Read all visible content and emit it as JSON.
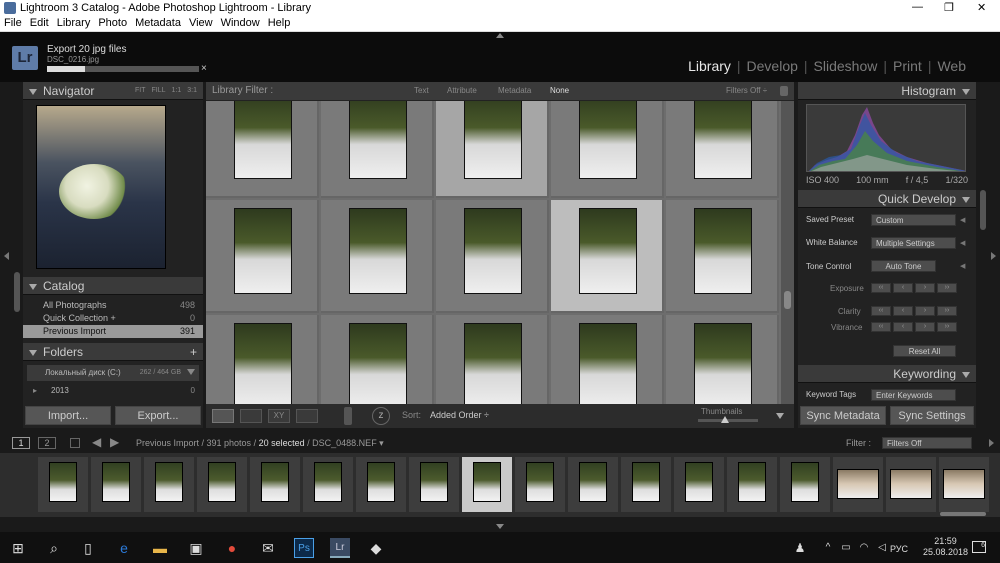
{
  "window": {
    "title": "Lightroom 3 Catalog - Adobe Photoshop Lightroom - Library",
    "controls": [
      "—",
      "❐",
      "✕"
    ]
  },
  "menu": [
    "File",
    "Edit",
    "Library",
    "Photo",
    "Metadata",
    "View",
    "Window",
    "Help"
  ],
  "identity": {
    "logo": "Lr",
    "export_title": "Export 20 jpg files",
    "export_file": "DSC_0216.jpg",
    "export_progress": 0.25,
    "close": "×",
    "modules": [
      "Library",
      "Develop",
      "Slideshow",
      "Print",
      "Web"
    ],
    "active_module": "Library",
    "separator": "|"
  },
  "navigator": {
    "title": "Navigator",
    "options": [
      "FIT",
      "FILL",
      "1:1",
      "3:1"
    ]
  },
  "catalog": {
    "title": "Catalog",
    "items": [
      {
        "label": "All Photographs",
        "count": "498"
      },
      {
        "label": "Quick Collection  +",
        "count": "0"
      },
      {
        "label": "Previous Import",
        "count": "391"
      }
    ]
  },
  "folders": {
    "title": "Folders",
    "add": "+",
    "drive": {
      "label": "Локальный диск (C:)",
      "size": "262 / 464 GB"
    },
    "items": [
      {
        "label": "2013",
        "count": "0"
      }
    ]
  },
  "left_buttons": {
    "import": "Import...",
    "export": "Export..."
  },
  "filter_bar": {
    "label": "Library Filter :",
    "options": [
      "Text",
      "Attribute",
      "Metadata",
      "None"
    ],
    "active": "None",
    "filters_off": "Filters Off ÷"
  },
  "toolbar": {
    "sort_label": "Sort:",
    "sort_value": "Added Order ÷",
    "thumbnails_label": "Thumbnails",
    "thumbnail_size": 0.45
  },
  "histogram": {
    "title": "Histogram",
    "iso": "ISO 400",
    "focal": "100 mm",
    "aperture": "f / 4,5",
    "shutter": "1/320"
  },
  "quick_develop": {
    "title": "Quick Develop",
    "saved_preset_label": "Saved Preset",
    "saved_preset_value": "Custom",
    "white_balance_label": "White Balance",
    "white_balance_value": "Multiple Settings",
    "tone_control_label": "Tone Control",
    "auto_tone": "Auto Tone",
    "exposure_label": "Exposure",
    "clarity_label": "Clarity",
    "vibrance_label": "Vibrance",
    "reset_all": "Reset All"
  },
  "keywording": {
    "title": "Keywording",
    "keyword_tags_label": "Keyword Tags",
    "keyword_tags_value": "Enter Keywords"
  },
  "right_buttons": {
    "sync_metadata": "Sync Metadata",
    "sync_settings": "Sync Settings"
  },
  "filmstrip_header": {
    "screen1": "1",
    "screen2": "2",
    "path_prefix": "Previous Import / 391 photos /",
    "selected": "20 selected",
    "path_suffix": "/ DSC_0488.NEF ▾",
    "filter_label": "Filter :",
    "filter_value": "Filters Off"
  },
  "taskbar": {
    "time": "21:59",
    "date": "25.08.2018",
    "lang": "РУС",
    "notifications": "6"
  }
}
